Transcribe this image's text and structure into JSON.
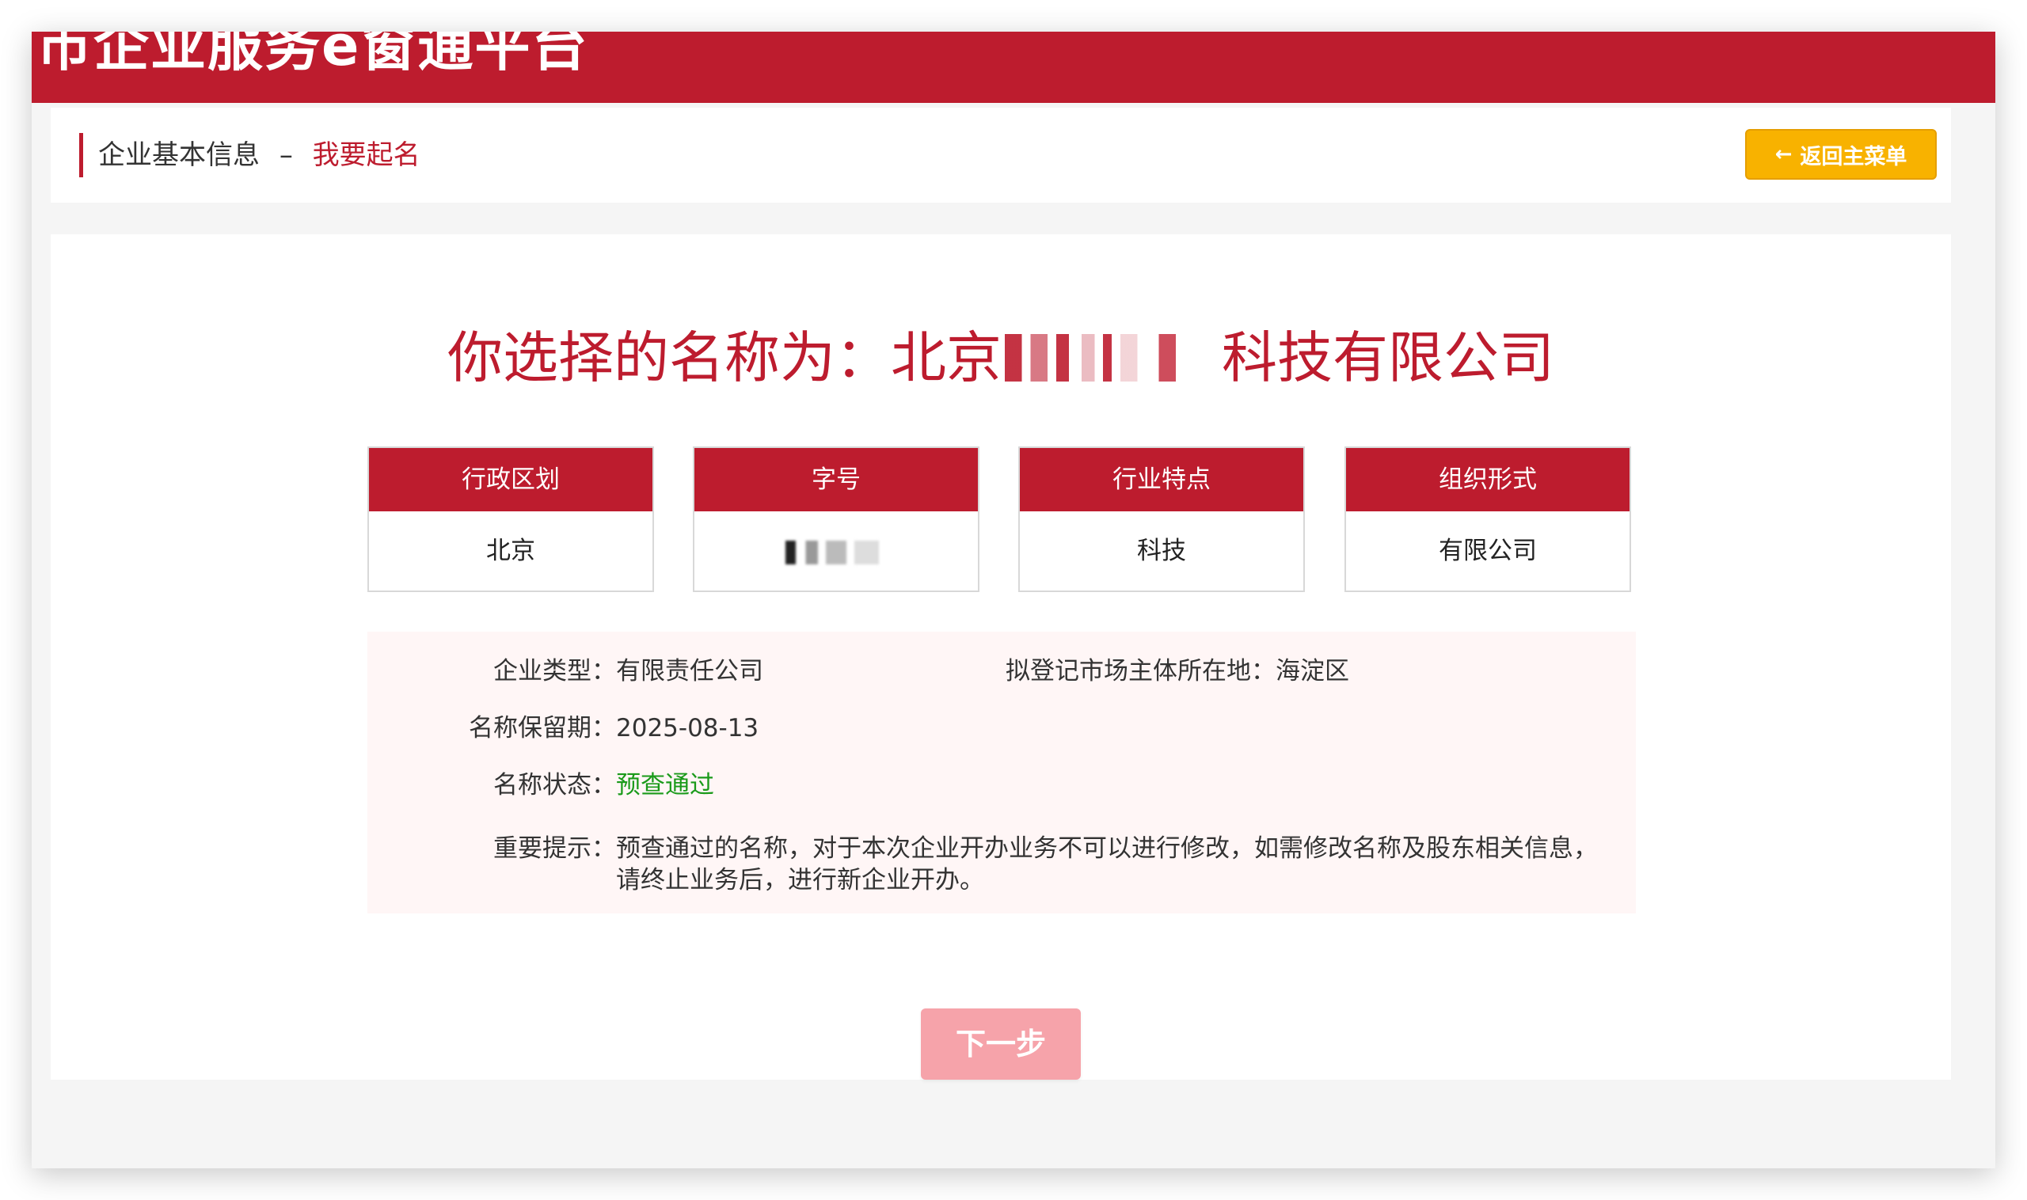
{
  "header": {
    "title": "市企业服务e窗通平台"
  },
  "breadcrumb": {
    "parent": "企业基本信息",
    "separator": "–",
    "current": "我要起名"
  },
  "back_button": {
    "arrow": "←",
    "label": "返回主菜单"
  },
  "selection": {
    "prefix": "你选择的名称为：北京",
    "suffix": "科技有限公司"
  },
  "segments": [
    {
      "header": "行政区划",
      "value": "北京"
    },
    {
      "header": "字号",
      "value": ""
    },
    {
      "header": "行业特点",
      "value": "科技"
    },
    {
      "header": "组织形式",
      "value": "有限公司"
    }
  ],
  "details": {
    "enterprise_type_label": "企业类型：",
    "enterprise_type_value": "有限责任公司",
    "location_label": "拟登记市场主体所在地：",
    "location_value": "海淀区",
    "reserve_label": "名称保留期：",
    "reserve_value": "2025-08-13",
    "status_label": "名称状态：",
    "status_value": "预查通过",
    "tip_label": "重要提示：",
    "tip_value": "预查通过的名称，对于本次企业开办业务不可以进行修改，如需修改名称及股东相关信息，请终止业务后，进行新企业开办。"
  },
  "next_button": {
    "label": "下一步"
  },
  "colors": {
    "brand_red": "#bd1c2e",
    "warning_yellow": "#f8b200",
    "success_green": "#1a9a1a",
    "disabled_pink": "#f6a3aa"
  }
}
